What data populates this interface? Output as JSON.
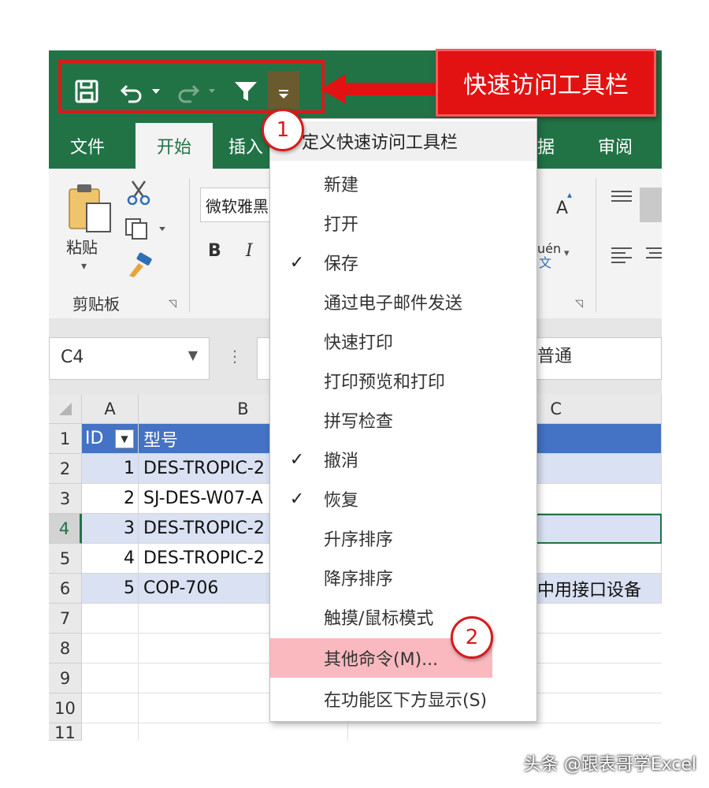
{
  "qat": {
    "callout": "快速访问工具栏",
    "badge1": "1",
    "badge2": "2"
  },
  "tabs": [
    "文件",
    "开始",
    "插入",
    "据",
    "审阅"
  ],
  "ribbon": {
    "paste_label": "粘贴",
    "clipboard_group": "剪贴板",
    "font_name": "微软雅黑",
    "bold": "B",
    "italic": "I",
    "font_grow": "A",
    "phonetic_top": "uén",
    "phonetic_bottom": "文"
  },
  "formula": {
    "name_box": "C4",
    "separator": "⋮",
    "visible_value": "普通"
  },
  "grid": {
    "columns": [
      "A",
      "B",
      "C"
    ],
    "rows": [
      "1",
      "2",
      "3",
      "4",
      "5",
      "6",
      "7",
      "8",
      "9",
      "10",
      "11"
    ],
    "header": {
      "id": "ID",
      "model": "型号"
    },
    "data": [
      {
        "id": "1",
        "model": "DES-TROPIC-2",
        "c": ""
      },
      {
        "id": "2",
        "model": "SJ-DES-W07-A",
        "c": ""
      },
      {
        "id": "3",
        "model": "DES-TROPIC-2",
        "c": ""
      },
      {
        "id": "4",
        "model": "DES-TROPIC-2",
        "c": ""
      },
      {
        "id": "5",
        "model": "COP-706",
        "c": "中用接口设备"
      }
    ]
  },
  "menu": {
    "title": "定义快速访问工具栏",
    "items": [
      {
        "label": "新建",
        "checked": ""
      },
      {
        "label": "打开",
        "checked": ""
      },
      {
        "label": "保存",
        "checked": "✓"
      },
      {
        "label": "通过电子邮件发送",
        "checked": ""
      },
      {
        "label": "快速打印",
        "checked": ""
      },
      {
        "label": "打印预览和打印",
        "checked": ""
      },
      {
        "label": "拼写检查",
        "checked": ""
      },
      {
        "label": "撤消",
        "checked": "✓"
      },
      {
        "label": "恢复",
        "checked": "✓"
      },
      {
        "label": "升序排序",
        "checked": ""
      },
      {
        "label": "降序排序",
        "checked": ""
      },
      {
        "label": "触摸/鼠标模式",
        "checked": ""
      },
      {
        "label": "其他命令(M)...",
        "checked": ""
      },
      {
        "label": "在功能区下方显示(S)",
        "checked": ""
      }
    ]
  },
  "watermark": "头条 @跟表哥学Excel",
  "colors": {
    "excel_green": "#217346",
    "callout_red": "#e31212",
    "table_blue": "#4472c4",
    "band": "#d9e1f2"
  }
}
